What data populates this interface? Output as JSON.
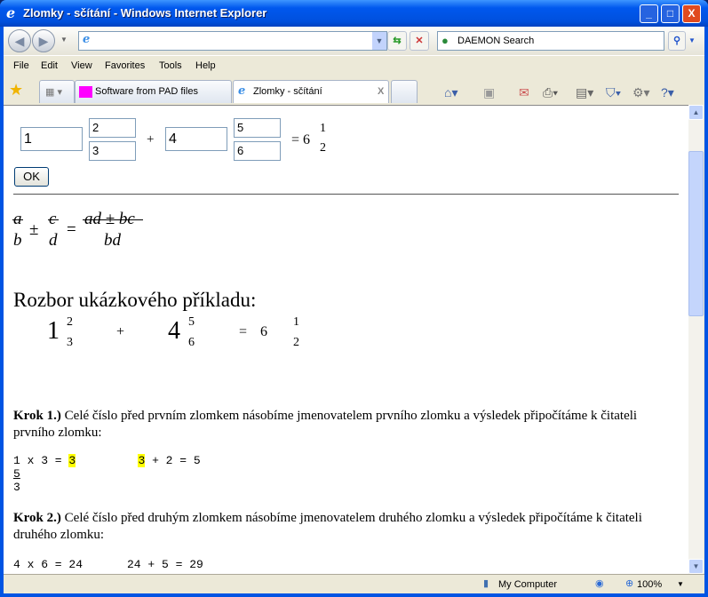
{
  "window": {
    "title": "Zlomky - sčítání - Windows Internet Explorer",
    "minimize": "_",
    "maximize": "□",
    "close": "X"
  },
  "address": {
    "value": ""
  },
  "search": {
    "placeholder": "DAEMON Search"
  },
  "menu": [
    "File",
    "Edit",
    "View",
    "Favorites",
    "Tools",
    "Help"
  ],
  "tabs": [
    {
      "label": "Software from PAD files"
    },
    {
      "label": "Zlomky - sčítání",
      "close": "X"
    }
  ],
  "form": {
    "whole1": "1",
    "num1": "2",
    "den1": "3",
    "plus": "+",
    "whole2": "4",
    "num2": "5",
    "den2": "6",
    "equals": "= 6",
    "res_num": "1",
    "res_den": "2",
    "ok": "OK"
  },
  "formula": {
    "a": "a",
    "b": "b",
    "pm": "±",
    "c": "c",
    "d": "d",
    "eq": "=",
    "num": "ad ± bc",
    "den": "bd"
  },
  "example": {
    "heading": "Rozbor ukázkového příkladu:",
    "w1": "1",
    "n1": "2",
    "d1": "3",
    "plus": "+",
    "w2": "4",
    "n2": "5",
    "d2": "6",
    "eq": "=",
    "w3": "6",
    "n3": "1",
    "d3": "2"
  },
  "steps": [
    {
      "label": "Krok 1.)",
      "text": " Celé číslo před prvním zlomkem násobíme jmenovatelem prvního zlomku a výsledek připočítáme k čitateli prvního zlomku:",
      "calc_a": "1 x 3 = ",
      "hl_a": "3",
      "hl_b": "3",
      "calc_b": " + 2 = 5",
      "frac_num": "5",
      "frac_den": "3"
    },
    {
      "label": "Krok 2.)",
      "text": " Celé číslo před druhým zlomkem násobíme jmenovatelem druhého zlomku a výsledek připočítáme k čitateli druhého zlomku:",
      "calc_a": "4 x 6 = 24",
      "calc_b": "24 + 5 = 29"
    }
  ],
  "status": {
    "zone": "My Computer",
    "zoom": "100%"
  }
}
